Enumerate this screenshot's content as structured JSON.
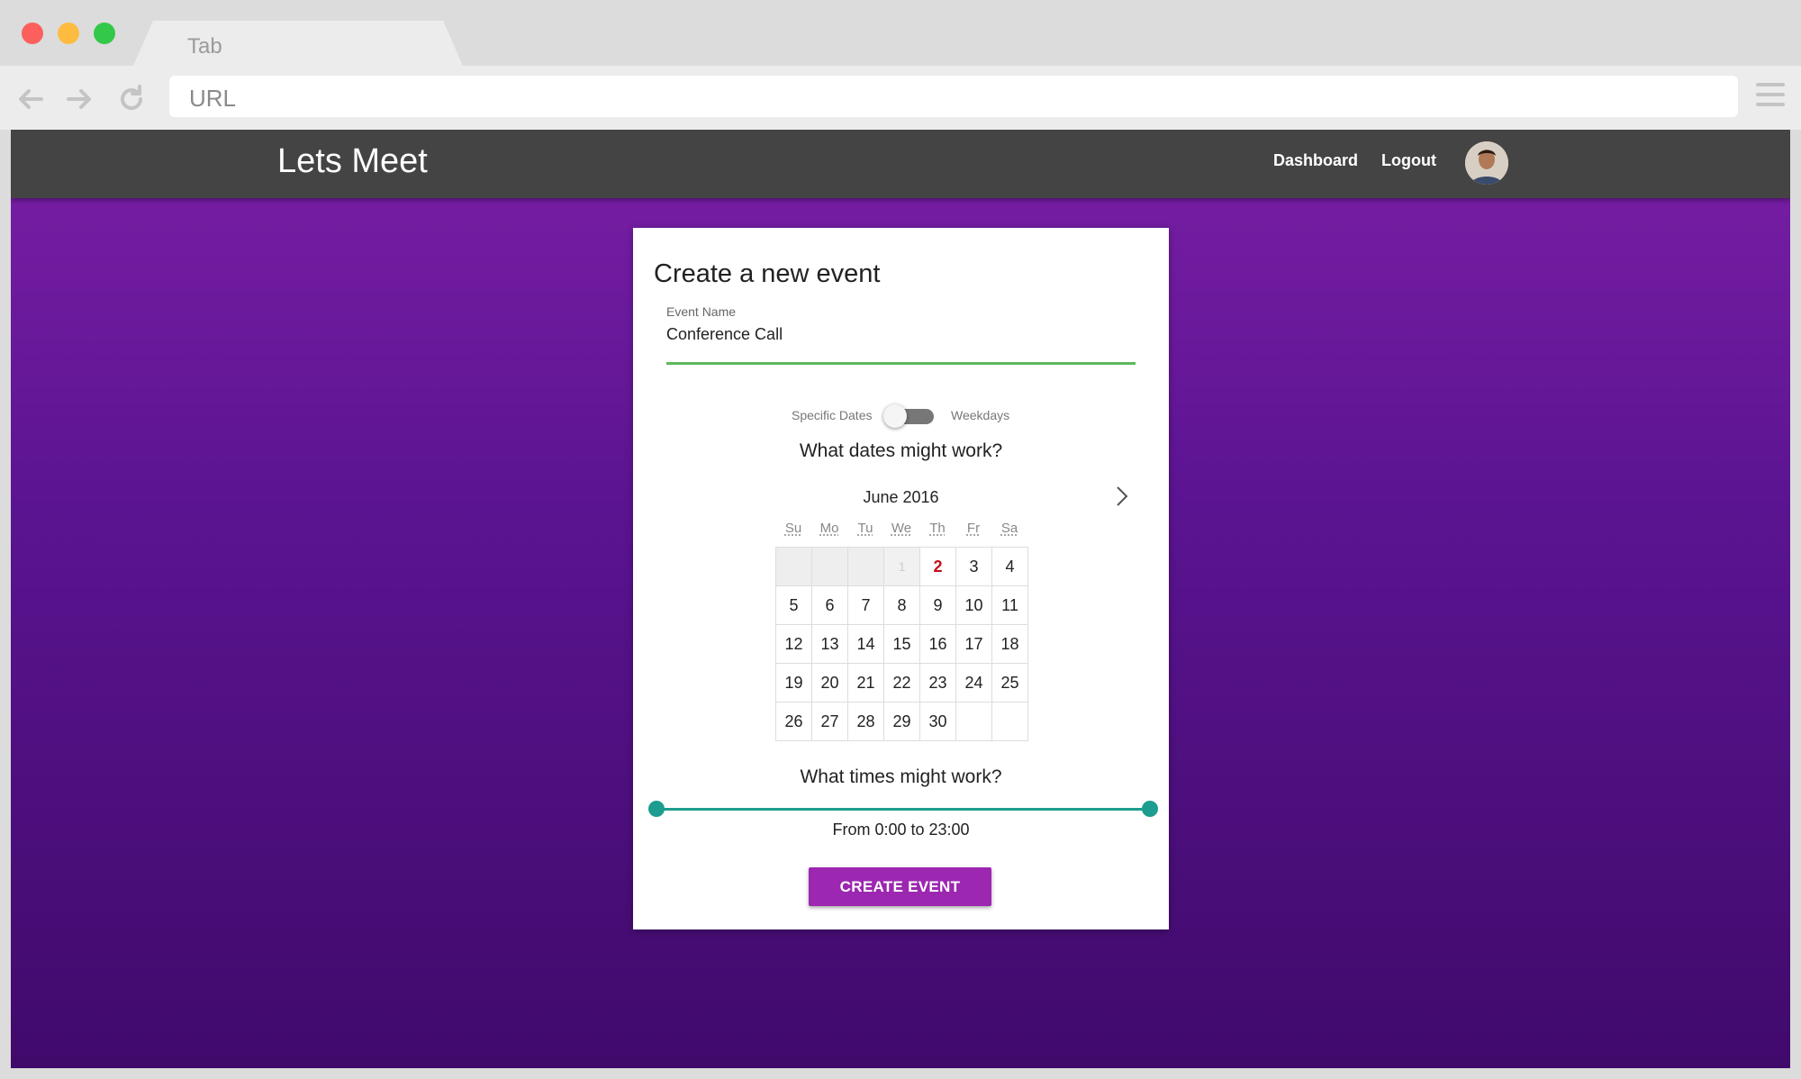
{
  "browser": {
    "tab_title": "Tab",
    "url_placeholder": "URL"
  },
  "header": {
    "brand": "Lets Meet",
    "nav": [
      "Dashboard",
      "Logout"
    ]
  },
  "form": {
    "title": "Create a new event",
    "event_name_label": "Event Name",
    "event_name_value": "Conference Call",
    "toggle": {
      "left_label": "Specific Dates",
      "right_label": "Weekdays",
      "state": "Specific Dates"
    },
    "dates_question": "What dates might work?",
    "calendar": {
      "month": "June 2016",
      "weekdays": [
        "Su",
        "Mo",
        "Tu",
        "We",
        "Th",
        "Fr",
        "Sa"
      ],
      "weeks": [
        [
          "",
          "",
          "",
          "1",
          "2",
          "3",
          "4"
        ],
        [
          "5",
          "6",
          "7",
          "8",
          "9",
          "10",
          "11"
        ],
        [
          "12",
          "13",
          "14",
          "15",
          "16",
          "17",
          "18"
        ],
        [
          "19",
          "20",
          "21",
          "22",
          "23",
          "24",
          "25"
        ],
        [
          "26",
          "27",
          "28",
          "29",
          "30",
          "",
          ""
        ]
      ],
      "today": "2",
      "disabled_days": [
        "1"
      ]
    },
    "times_question": "What times might work?",
    "time_range": {
      "from": "0:00",
      "to": "23:00",
      "text": "From 0:00 to 23:00"
    },
    "submit_label": "CREATE EVENT"
  },
  "colors": {
    "accent": "#9c27b0",
    "slider": "#1c9d8f",
    "input_focus": "#5cb85c",
    "today": "#c0101b",
    "header_bg": "#444444"
  }
}
